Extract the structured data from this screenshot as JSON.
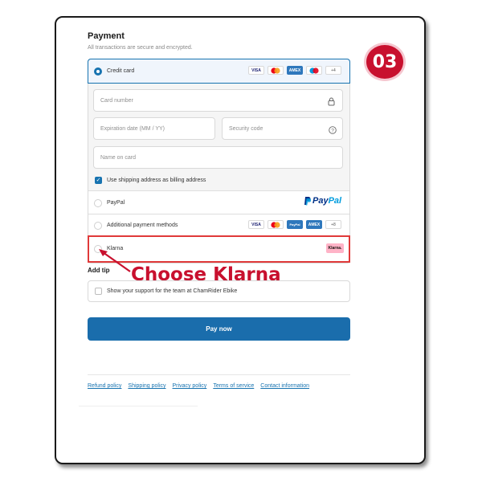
{
  "step_badge": "03",
  "payment": {
    "title": "Payment",
    "subtitle": "All transactions are secure and encrypted.",
    "credit_card": {
      "label": "Credit card",
      "logos": [
        "VISA",
        "MC",
        "AMEX",
        "MAESTRO"
      ],
      "more": "+4",
      "card_number_placeholder": "Card number",
      "expiration_placeholder": "Expiration date (MM / YY)",
      "security_code_placeholder": "Security code",
      "name_on_card_placeholder": "Name on card",
      "billing_checkbox_label": "Use shipping address as billing address",
      "billing_checked": true
    },
    "paypal": {
      "label": "PayPal",
      "logo_text_pay": "Pay",
      "logo_text_pal": "Pal"
    },
    "additional": {
      "label": "Additional payment methods",
      "logos": [
        "VISA",
        "MC",
        "PayPal",
        "AMEX"
      ],
      "more": "+8"
    },
    "klarna": {
      "label": "Klarna",
      "logo": "Klarna."
    }
  },
  "callout": "Choose Klarna",
  "tip": {
    "title": "Add tip",
    "checkbox_label": "Show your support for the team at ChamRider Ebike"
  },
  "pay_now": "Pay now",
  "footer": {
    "links": [
      "Refund policy",
      "Shipping policy",
      "Privacy policy",
      "Terms of service",
      "Contact information"
    ]
  },
  "colors": {
    "accent": "#1773b0",
    "button": "#1a6dac",
    "highlight": "#e03a3a",
    "callout": "#c8102e",
    "klarna_pink": "#ffb3c7"
  }
}
